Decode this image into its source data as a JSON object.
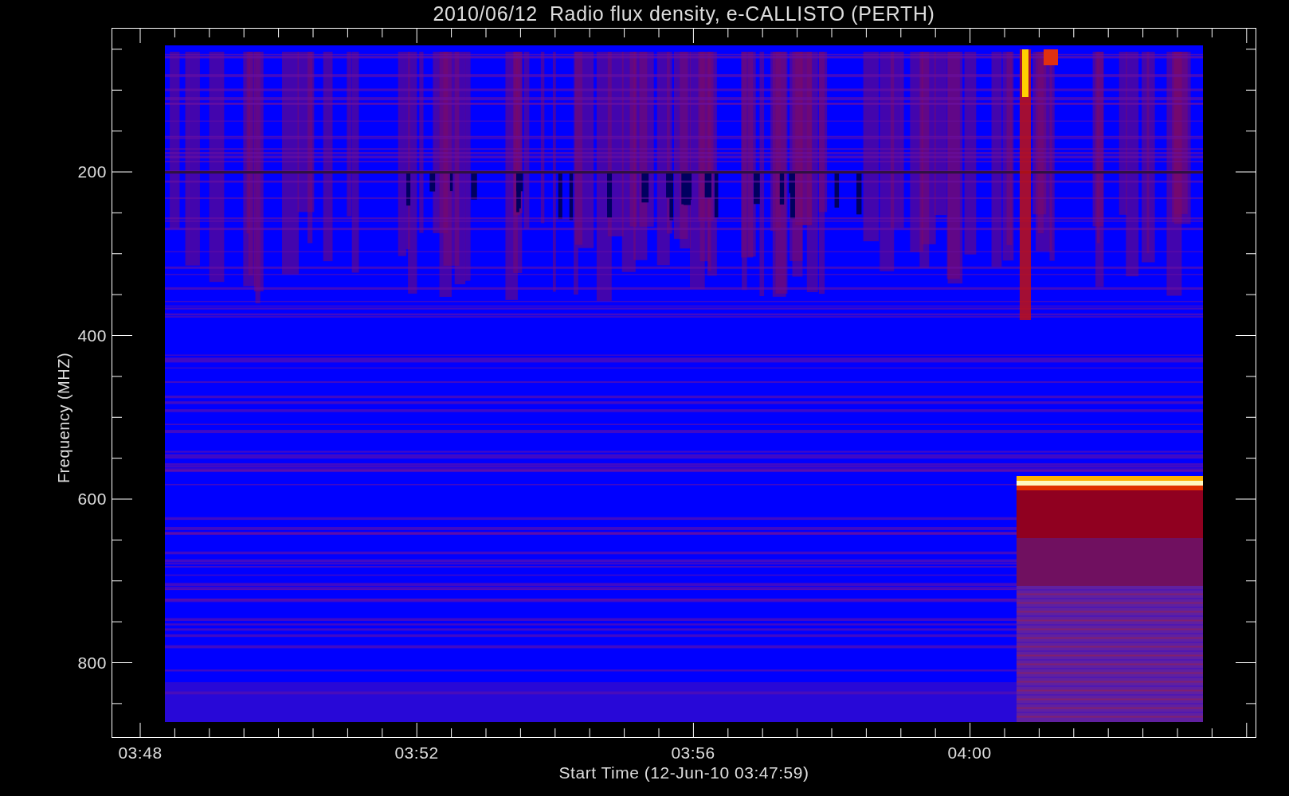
{
  "title": "2010/06/12  Radio flux density, e-CALLISTO (PERTH)",
  "y_axis": {
    "label": "Frequency (MHZ)",
    "ticks": [
      "200",
      "400",
      "600",
      "800"
    ]
  },
  "x_axis": {
    "label": "Start Time (12-Jun-10 03:47:59)",
    "ticks": [
      "03:48",
      "03:52",
      "03:56",
      "04:00"
    ]
  }
}
